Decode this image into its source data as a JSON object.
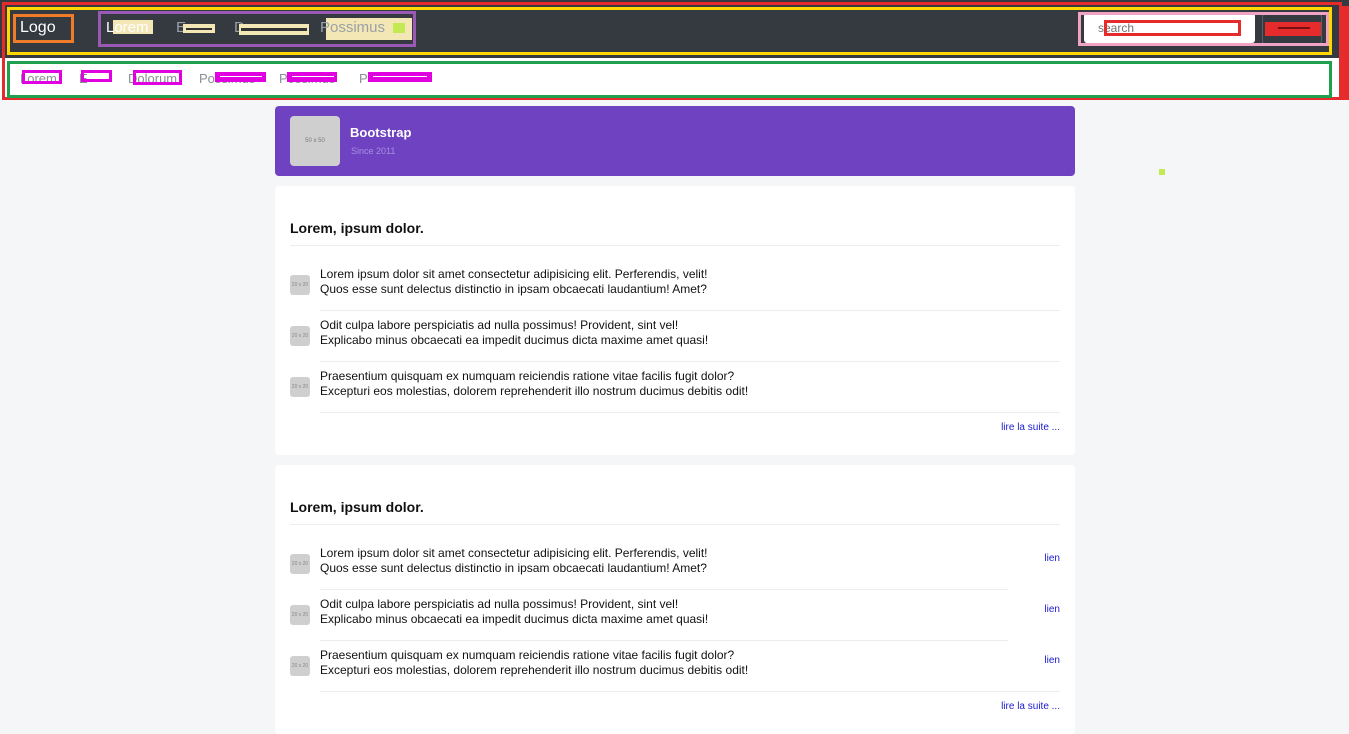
{
  "navbar": {
    "logo": "Logo",
    "links": [
      {
        "label": "Lorem",
        "active": true
      },
      {
        "label": "E"
      },
      {
        "label": "D"
      },
      {
        "label": "Possimus"
      }
    ],
    "search_placeholder": "search"
  },
  "subnav": {
    "links": [
      "Lorem",
      "E",
      "Dolorum",
      "Possimus",
      "Possimus",
      "P"
    ]
  },
  "brand": {
    "thumb_label": "50 x 50",
    "title": "Bootstrap",
    "subtitle": "Since 2011"
  },
  "cards": [
    {
      "title": "Lorem, ipsum dolor.",
      "items": [
        {
          "avatar": "20 x 20",
          "line1": "Lorem ipsum dolor sit amet consectetur adipisicing elit. Perferendis, velit!",
          "line2": "Quos esse sunt delectus distinctio in ipsam obcaecati laudantium! Amet?"
        },
        {
          "avatar": "20 x 20",
          "line1": "Odit culpa labore perspiciatis ad nulla possimus! Provident, sint vel!",
          "line2": "Explicabo minus obcaecati ea impedit ducimus dicta maxime amet quasi!"
        },
        {
          "avatar": "20 x 20",
          "line1": "Praesentium quisquam ex numquam reiciendis ratione vitae facilis fugit dolor?",
          "line2": "Excepturi eos molestias, dolorem reprehenderit illo nostrum ducimus debitis odit!"
        }
      ],
      "more": "lire la suite ..."
    },
    {
      "title": "Lorem, ipsum dolor.",
      "items": [
        {
          "avatar": "20 x 20",
          "line1": "Lorem ipsum dolor sit amet consectetur adipisicing elit. Perferendis, velit!",
          "line2": "Quos esse sunt delectus distinctio in ipsam obcaecati laudantium! Amet?",
          "link": "lien"
        },
        {
          "avatar": "20 x 20",
          "line1": "Odit culpa labore perspiciatis ad nulla possimus! Provident, sint vel!",
          "line2": "Explicabo minus obcaecati ea impedit ducimus dicta maxime amet quasi!",
          "link": "lien"
        },
        {
          "avatar": "20 x 20",
          "line1": "Praesentium quisquam ex numquam reiciendis ratione vitae facilis fugit dolor?",
          "line2": "Excepturi eos molestias, dolorem reprehenderit illo nostrum ducimus debitis odit!",
          "link": "lien"
        }
      ],
      "more": "lire la suite ..."
    }
  ],
  "colors": {
    "navbar_bg": "#343a40",
    "brand_bg": "#6f42c1",
    "link": "#1a1ad0",
    "page_bg": "#f5f6f8"
  }
}
